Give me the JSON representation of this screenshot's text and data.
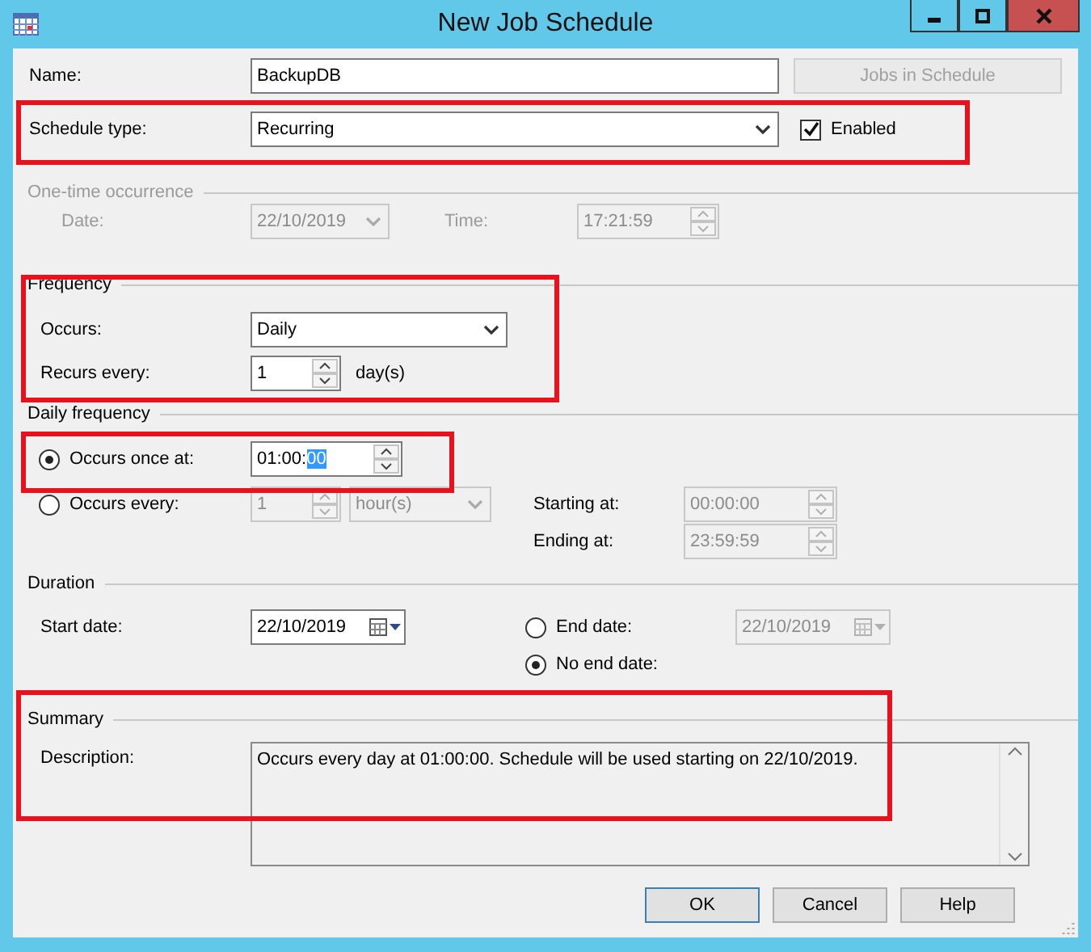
{
  "window": {
    "title": "New Job Schedule"
  },
  "name": {
    "label": "Name:",
    "value": "BackupDB"
  },
  "jobs_button": {
    "label": "Jobs in Schedule",
    "disabled": true
  },
  "schedule_type": {
    "label": "Schedule type:",
    "value": "Recurring"
  },
  "enabled": {
    "label": "Enabled",
    "checked": true
  },
  "one_time": {
    "title": "One-time occurrence",
    "disabled": true,
    "date_label": "Date:",
    "date": "22/10/2019",
    "time_label": "Time:",
    "time": "17:21:59"
  },
  "frequency": {
    "title": "Frequency",
    "occurs_label": "Occurs:",
    "occurs": "Daily",
    "recurs_label": "Recurs every:",
    "recurs": "1",
    "unit": "day(s)"
  },
  "daily_frequency": {
    "title": "Daily frequency",
    "once": {
      "label": "Occurs once at:",
      "selected": true,
      "segments": [
        {
          "text": "01:00:",
          "selected": false
        },
        {
          "text": "00",
          "selected": true
        }
      ]
    },
    "every": {
      "label": "Occurs every:",
      "selected": false,
      "disabled": true,
      "value": "1",
      "unit": "hour(s)",
      "starting_label": "Starting at:",
      "starting": "00:00:00",
      "ending_label": "Ending at:",
      "ending": "23:59:59"
    }
  },
  "duration": {
    "title": "Duration",
    "start_label": "Start date:",
    "start_date": "22/10/2019",
    "end_date_option": {
      "label": "End date:",
      "selected": false
    },
    "end_date": "22/10/2019",
    "no_end_option": {
      "label": "No end date:",
      "selected": true
    }
  },
  "summary": {
    "title": "Summary",
    "label": "Description:",
    "description": "Occurs every day at 01:00:00. Schedule will be used starting on 22/10/2019."
  },
  "buttons": [
    {
      "label": "OK",
      "default": true
    },
    {
      "label": "Cancel",
      "default": false
    },
    {
      "label": "Help",
      "default": false
    }
  ]
}
